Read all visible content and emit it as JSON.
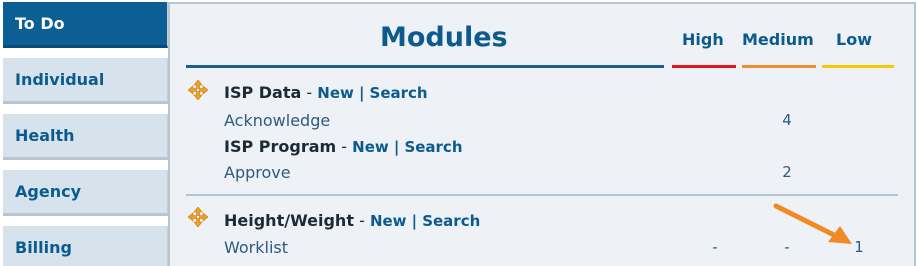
{
  "sidebar": {
    "tabs": [
      {
        "label": "To Do",
        "active": true
      },
      {
        "label": "Individual",
        "active": false
      },
      {
        "label": "Health",
        "active": false
      },
      {
        "label": "Agency",
        "active": false
      },
      {
        "label": "Billing",
        "active": false
      }
    ]
  },
  "main": {
    "title": "Modules",
    "columns": {
      "high": "High",
      "medium": "Medium",
      "low": "Low"
    },
    "priority_colors": {
      "high": "#e4141b",
      "medium": "#f0902a",
      "low": "#f5c800"
    },
    "modules": [
      {
        "name": "ISP Data",
        "dash": "-",
        "new_label": "New",
        "sep": "|",
        "search_label": "Search",
        "tasks": [
          {
            "label": "Acknowledge",
            "high": "",
            "medium": "4",
            "low": ""
          }
        ]
      },
      {
        "name": "ISP Program",
        "dash": "-",
        "new_label": "New",
        "sep": "|",
        "search_label": "Search",
        "tasks": [
          {
            "label": "Approve",
            "high": "",
            "medium": "2",
            "low": ""
          }
        ]
      },
      {
        "name": "Height/Weight",
        "dash": "-",
        "new_label": "New",
        "sep": "|",
        "search_label": "Search",
        "tasks": [
          {
            "label": "Worklist",
            "high": "-",
            "medium": "-",
            "low": "1"
          }
        ]
      }
    ]
  },
  "icons": {
    "module": "move-arrows-icon",
    "annotation": "orange-arrow-icon"
  }
}
